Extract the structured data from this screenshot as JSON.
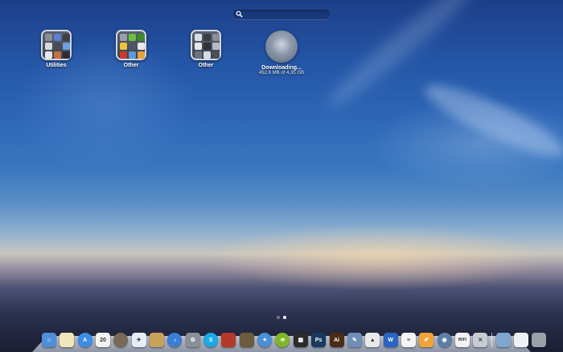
{
  "search": {
    "placeholder": ""
  },
  "folders": [
    {
      "label": "Utilities",
      "tiles": [
        "#8a8f98",
        "#5b7fd3",
        "#3d3f45",
        "#d9d9d9",
        "#4a4c52",
        "#6aa0e6",
        "#e7e7e7",
        "#c96f3c",
        "#2d2e33"
      ]
    },
    {
      "label": "Other",
      "tiles": [
        "#9aa0a8",
        "#6bbf3a",
        "#3d8a2f",
        "#f0c23a",
        "#4e5664",
        "#e7e7e7",
        "#c83c2d",
        "#5a9bd8",
        "#e8a13a"
      ]
    },
    {
      "label": "Other",
      "tiles": [
        "#dadde2",
        "#3b3d42",
        "#8a8f98",
        "#e7e7e7",
        "#2f3136",
        "#b7bcc4",
        "#6d7380",
        "#d8dbe0",
        "#4b4f57"
      ]
    }
  ],
  "download": {
    "title": "Downloading...",
    "progress_text": "452,6 MB of 4,35 GB"
  },
  "pages": {
    "count": 2,
    "active": 2
  },
  "dock": {
    "apps": [
      {
        "name": "finder-icon",
        "color": "#4f8ed8",
        "glyph": "☺",
        "shape": "square"
      },
      {
        "name": "notes-icon",
        "color": "#f0e6b8",
        "glyph": "",
        "shape": "square"
      },
      {
        "name": "app-store-icon",
        "color": "#3a8ee6",
        "glyph": "A",
        "shape": "round"
      },
      {
        "name": "calendar-icon",
        "color": "#f2f2f2",
        "glyph": "20",
        "shape": "square"
      },
      {
        "name": "contacts-icon",
        "color": "#7a6a55",
        "glyph": "",
        "shape": "round"
      },
      {
        "name": "mail-icon",
        "color": "#e8eef6",
        "glyph": "✈",
        "shape": "square"
      },
      {
        "name": "archive-icon",
        "color": "#c9a25a",
        "glyph": "",
        "shape": "square"
      },
      {
        "name": "itunes-icon",
        "color": "#3b7fd4",
        "glyph": "♪",
        "shape": "round"
      },
      {
        "name": "preferences-icon",
        "color": "#8a8f98",
        "glyph": "⚙",
        "shape": "square"
      },
      {
        "name": "skype-icon",
        "color": "#19a9e6",
        "glyph": "S",
        "shape": "round"
      },
      {
        "name": "photo-booth-icon",
        "color": "#b33a2a",
        "glyph": "",
        "shape": "square"
      },
      {
        "name": "iphoto-icon",
        "color": "#6d5a3f",
        "glyph": "",
        "shape": "square"
      },
      {
        "name": "safari-icon",
        "color": "#4a90d9",
        "glyph": "✦",
        "shape": "round"
      },
      {
        "name": "spotify-icon",
        "color": "#80b82a",
        "glyph": "≋",
        "shape": "round"
      },
      {
        "name": "movie-icon",
        "color": "#2b2b2b",
        "glyph": "▦",
        "shape": "square"
      },
      {
        "name": "photoshop-icon",
        "color": "#1a3a5e",
        "glyph": "Ps",
        "shape": "square"
      },
      {
        "name": "illustrator-icon",
        "color": "#4a2d12",
        "glyph": "Ai",
        "shape": "square"
      },
      {
        "name": "xcode-icon",
        "color": "#6f8fb8",
        "glyph": "✎",
        "shape": "square"
      },
      {
        "name": "graph-icon",
        "color": "#e9e9e9",
        "glyph": "▲",
        "shape": "square"
      },
      {
        "name": "word-icon",
        "color": "#2a66c0",
        "glyph": "W",
        "shape": "square"
      },
      {
        "name": "textedit-icon",
        "color": "#f4f4f4",
        "glyph": "≡",
        "shape": "square"
      },
      {
        "name": "pages-icon",
        "color": "#f1a33a",
        "glyph": "✐",
        "shape": "square"
      },
      {
        "name": "transmission-icon",
        "color": "#5c7fa8",
        "glyph": "◉",
        "shape": "round"
      },
      {
        "name": "wifi-icon",
        "color": "#f2f2f2",
        "glyph": "WiFi",
        "shape": "square"
      },
      {
        "name": "utility-icon",
        "color": "#c7ccd3",
        "glyph": "✕",
        "shape": "square"
      }
    ],
    "stacks": [
      {
        "name": "folder-icon",
        "color": "#7fa6cf",
        "glyph": "",
        "shape": "square"
      },
      {
        "name": "document-icon",
        "color": "#eef0f3",
        "glyph": "",
        "shape": "square"
      },
      {
        "name": "trash-icon",
        "color": "#9aa0a8",
        "glyph": "",
        "shape": "square"
      }
    ]
  }
}
